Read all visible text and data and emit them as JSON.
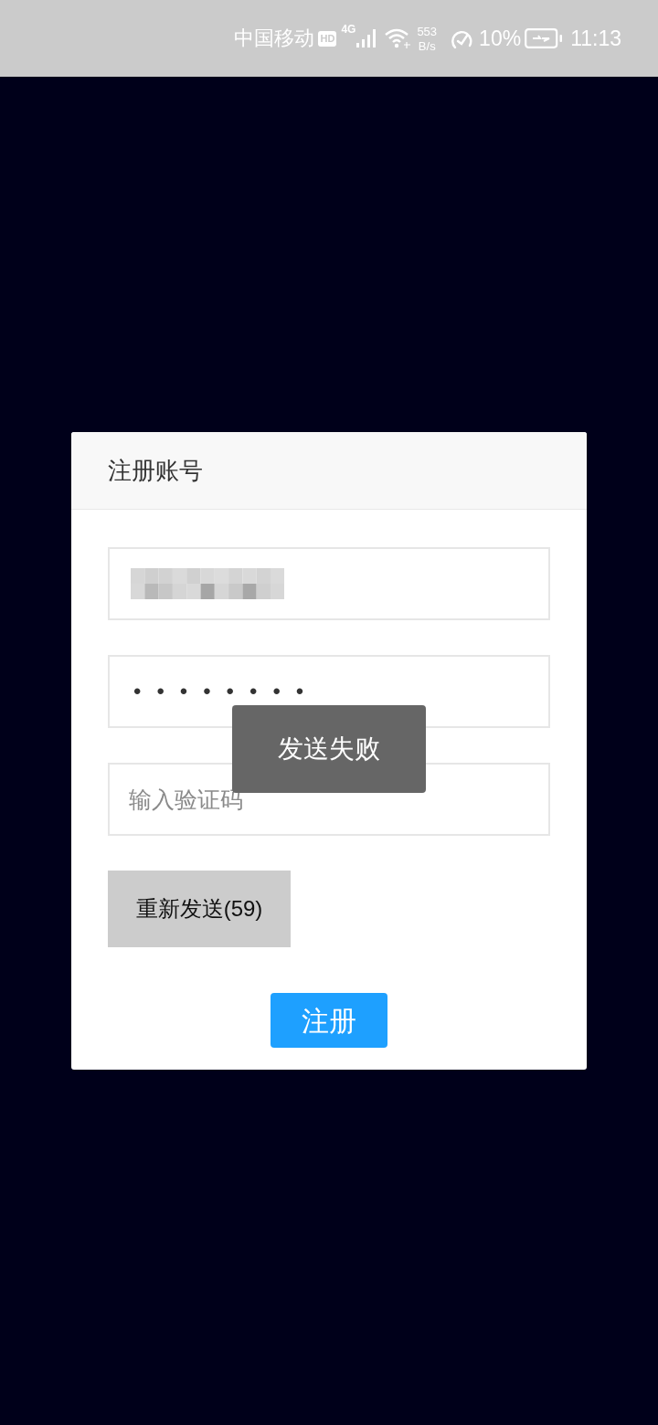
{
  "status_bar": {
    "carrier": "中国移动",
    "hd_badge": "HD",
    "network": "4G",
    "net_speed_value": "553",
    "net_speed_unit": "B/s",
    "battery_percent": "10%",
    "battery_charging": true,
    "time": "11:13"
  },
  "dialog": {
    "title": "注册账号",
    "fields": [
      {
        "kind": "redacted"
      },
      {
        "kind": "password",
        "value": "••••••••"
      },
      {
        "kind": "text",
        "placeholder": "输入验证码"
      }
    ],
    "resend_button": {
      "label": "重新发送(59)",
      "disabled": true
    },
    "submit_button": {
      "label": "注册"
    }
  },
  "toast": {
    "message": "发送失败"
  }
}
